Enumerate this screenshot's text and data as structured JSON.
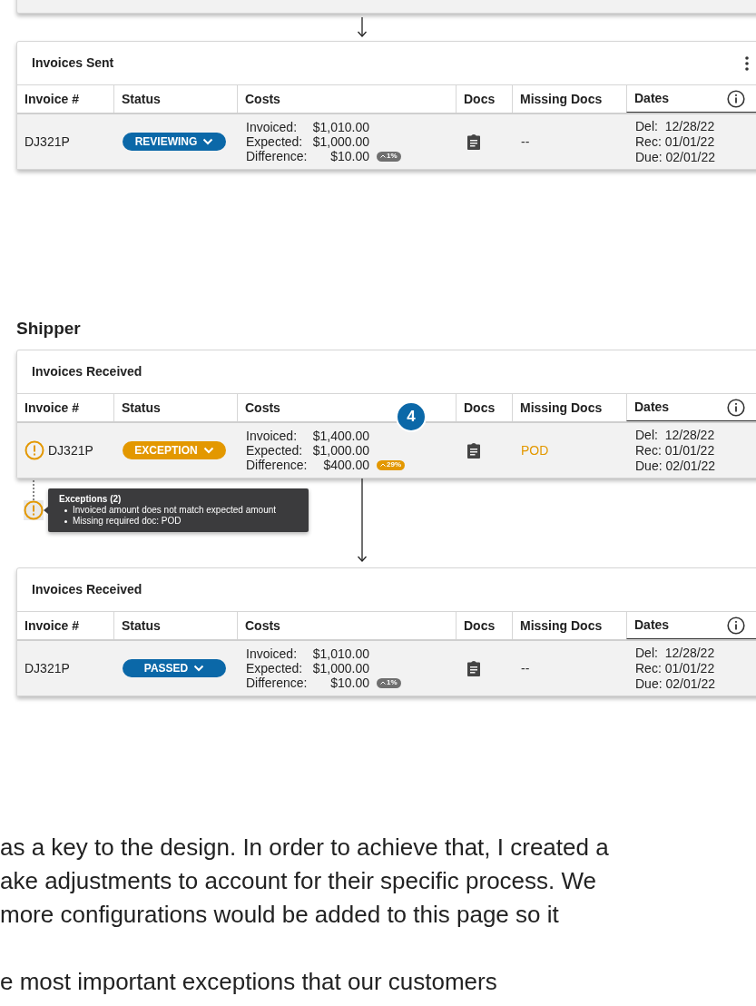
{
  "invoices_sent": {
    "title": "Invoices Sent",
    "has_menu": true,
    "columns": [
      "Invoice #",
      "Status",
      "Costs",
      "Docs",
      "Missing Docs",
      "Dates"
    ],
    "rows": [
      {
        "invoice": "DJ321P",
        "warning": false,
        "status": {
          "label": "REVIEWING",
          "color": "#0b68a8"
        },
        "costs": [
          {
            "label": "Invoiced:",
            "amount": "$1,010.00"
          },
          {
            "label": "Expected:",
            "amount": "$1,000.00"
          },
          {
            "label": "Difference:",
            "amount": "$10.00"
          }
        ],
        "change": {
          "value": "1%",
          "color": "#6f6f6f"
        },
        "has_doc": true,
        "missing_docs": {
          "text": "--",
          "color": "#333333"
        },
        "dates": [
          "Del:  12/28/22",
          "Rec: 01/01/22",
          "Due: 02/01/22"
        ]
      }
    ]
  },
  "shipper": {
    "title": "Shipper",
    "step_badge": "4",
    "cards": [
      {
        "title": "Invoices Received",
        "has_menu": false,
        "columns": [
          "Invoice #",
          "Status",
          "Costs",
          "Docs",
          "Missing Docs",
          "Dates"
        ],
        "rows": [
          {
            "invoice": "DJ321P",
            "warning": true,
            "status": {
              "label": "EXCEPTION",
              "color": "#e39800"
            },
            "costs": [
              {
                "label": "Invoiced:",
                "amount": "$1,400.00"
              },
              {
                "label": "Expected:",
                "amount": "$1,000.00"
              },
              {
                "label": "Difference:",
                "amount": "$400.00"
              }
            ],
            "change": {
              "value": "29%",
              "color": "#e39800"
            },
            "has_doc": true,
            "missing_docs": {
              "text": "POD",
              "color": "#e39800"
            },
            "dates": [
              "Del:  12/28/22",
              "Rec: 01/01/22",
              "Due: 02/01/22"
            ]
          }
        ]
      },
      {
        "title": "Invoices Received",
        "has_menu": false,
        "columns": [
          "Invoice #",
          "Status",
          "Costs",
          "Docs",
          "Missing Docs",
          "Dates"
        ],
        "rows": [
          {
            "invoice": "DJ321P",
            "warning": false,
            "status": {
              "label": "PASSED",
              "color": "#0b68a8"
            },
            "costs": [
              {
                "label": "Invoiced:",
                "amount": "$1,010.00"
              },
              {
                "label": "Expected:",
                "amount": "$1,000.00"
              },
              {
                "label": "Difference:",
                "amount": "$10.00"
              }
            ],
            "change": {
              "value": "1%",
              "color": "#6f6f6f"
            },
            "has_doc": true,
            "missing_docs": {
              "text": "--",
              "color": "#333333"
            },
            "dates": [
              "Del:  12/28/22",
              "Rec: 01/01/22",
              "Due: 02/01/22"
            ]
          }
        ]
      }
    ],
    "exceptions_tooltip": {
      "title": "Exceptions (2)",
      "items": [
        "Invoiced amount does not match expected amount",
        "Missing required doc: POD"
      ]
    }
  },
  "paragraphs": [
    [
      "as a key to the design. In order to achieve that, I created a",
      "ake adjustments to account for their specific process. We",
      "more configurations would be added to this page so it"
    ],
    [
      "e most important exceptions that our customers"
    ]
  ]
}
